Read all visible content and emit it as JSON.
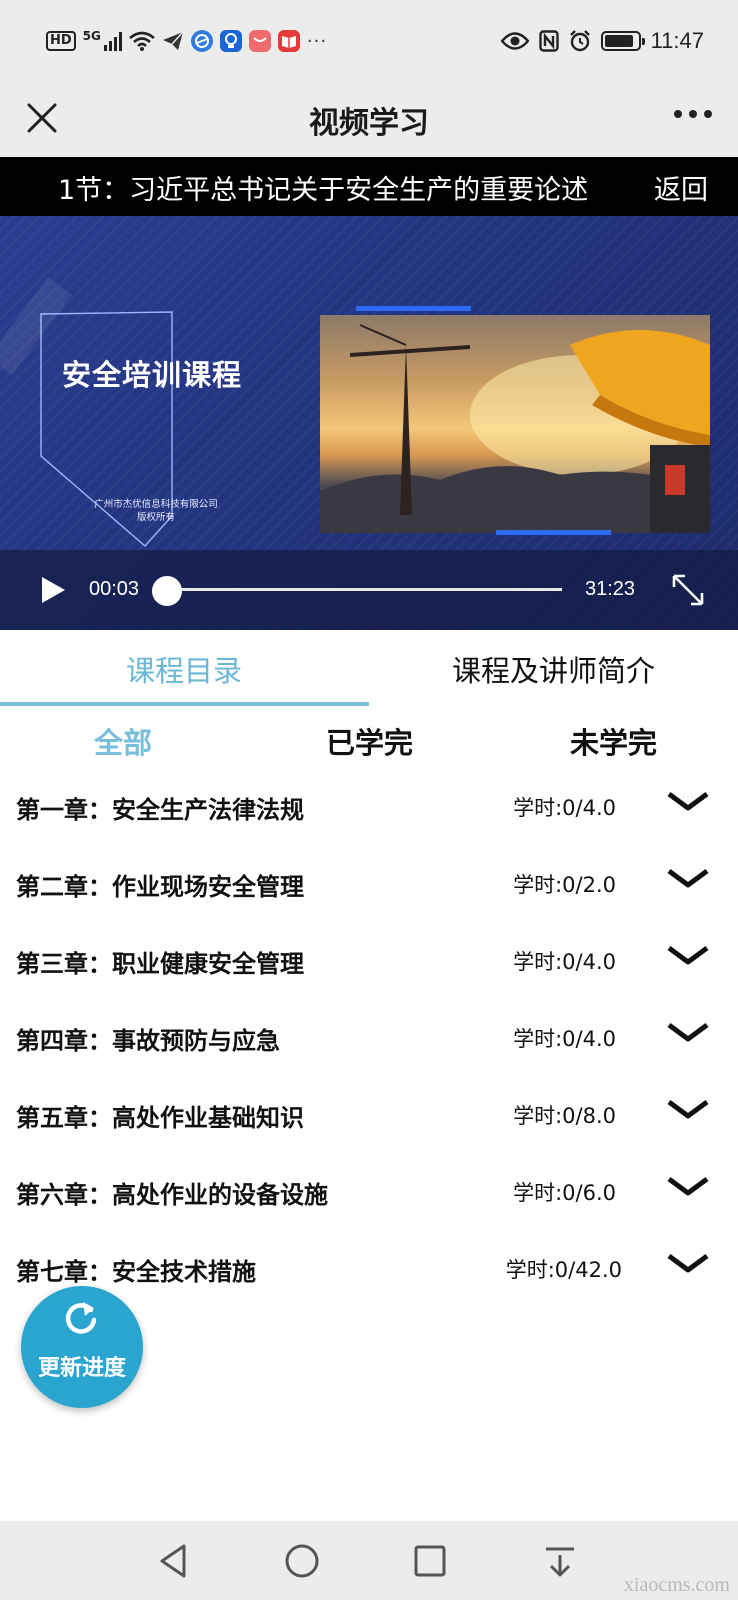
{
  "status_bar": {
    "hd": "HD",
    "network": "5G",
    "more": "···",
    "time": "11:47",
    "app_icons": [
      {
        "name": "telegram-icon",
        "color": "#333333"
      },
      {
        "name": "browser-icon",
        "color": "#2f7be0"
      },
      {
        "name": "bulb-app-icon",
        "color": "#1b66d6"
      },
      {
        "name": "shopping-app-icon",
        "color": "#f06b6b"
      },
      {
        "name": "book-app-icon",
        "color": "#e53a3a"
      }
    ]
  },
  "titlebar": {
    "title": "视频学习"
  },
  "lesson_bar": {
    "title": "1节：习近平总书记关于安全生产的重要论述",
    "back": "返回"
  },
  "video": {
    "slide_title": "安全培训课程",
    "company_line1": "广州市杰优信息科技有限公司",
    "company_line2": "版权所有",
    "current_time": "00:03",
    "duration": "31:23",
    "progress": 0.0016
  },
  "tabs": [
    {
      "label": "课程目录",
      "active": true
    },
    {
      "label": "课程及讲师简介",
      "active": false
    }
  ],
  "filters": [
    {
      "label": "全部",
      "active": true
    },
    {
      "label": "已学完",
      "active": false
    },
    {
      "label": "未学完",
      "active": false
    }
  ],
  "chapters": [
    {
      "title": "第一章：安全生产法律法规",
      "hours": "学时:0/4.0"
    },
    {
      "title": "第二章：作业现场安全管理",
      "hours": "学时:0/2.0"
    },
    {
      "title": "第三章：职业健康安全管理",
      "hours": "学时:0/4.0"
    },
    {
      "title": "第四章：事故预防与应急",
      "hours": "学时:0/4.0"
    },
    {
      "title": "第五章：高处作业基础知识",
      "hours": "学时:0/8.0"
    },
    {
      "title": "第六章：高处作业的设备设施",
      "hours": "学时:0/6.0"
    },
    {
      "title": "第七章：安全技术措施",
      "hours": "学时:0/42.0"
    }
  ],
  "update_button": {
    "label": "更新进度"
  },
  "watermark": "xiaocms.com",
  "colors": {
    "accent": "#6ab7d6",
    "fab": "#2aa5cf",
    "video_bg": "#23357f"
  }
}
